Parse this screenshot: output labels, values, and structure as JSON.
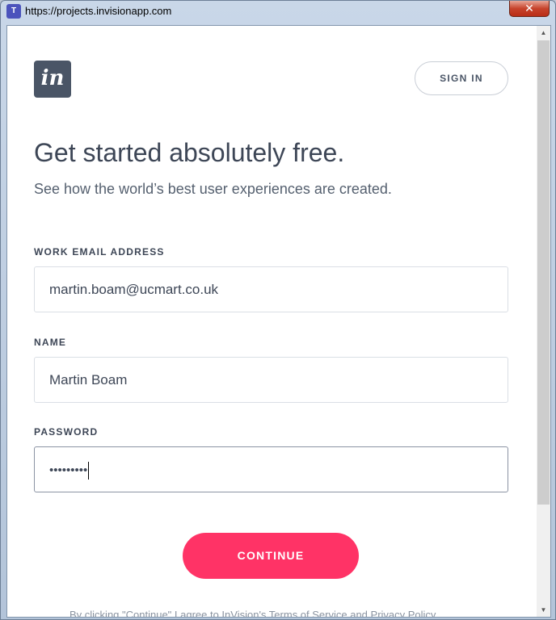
{
  "window": {
    "title": "https://projects.invisionapp.com",
    "app_icon_glyph": "T",
    "close_glyph": "✕"
  },
  "brand": {
    "logo_text": "in",
    "logo_color": "#4a5566",
    "accent_color": "#ff3366"
  },
  "header": {
    "signin_label": "SIGN IN"
  },
  "hero": {
    "headline": "Get started absolutely free.",
    "subheadline": "See how the world’s best user experiences are created."
  },
  "form": {
    "email": {
      "label": "WORK EMAIL ADDRESS",
      "value": "martin.boam@ucmart.co.uk"
    },
    "name": {
      "label": "NAME",
      "value": "Martin Boam"
    },
    "password": {
      "label": "PASSWORD",
      "masked_value": "•••••••••"
    },
    "submit_label": "CONTINUE"
  },
  "footer": {
    "terms_text": "By clicking \"Continue\" I agree to InVision's Terms of Service and Privacy Policy"
  },
  "scrollbar": {
    "up_glyph": "▲",
    "down_glyph": "▼"
  }
}
